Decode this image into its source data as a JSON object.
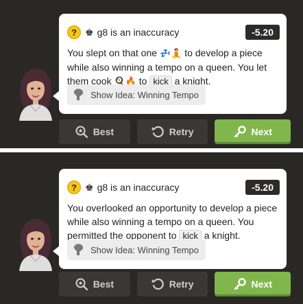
{
  "panels": [
    {
      "move": "g8",
      "verdict": "is an inaccuracy",
      "eval": "-5.20",
      "message": {
        "text1": "You slept on that one ",
        "emoji1": "💤🧘",
        "text2": " to develop a piece while also winning a tempo on a queen. You let them cook ",
        "emoji2": "🍳🔥",
        "text3": " to ",
        "tag": "kick",
        "text4": " a knight."
      },
      "idea": "Show Idea: Winning Tempo",
      "buttons": {
        "best": "Best",
        "retry": "Retry",
        "next": "Next"
      }
    },
    {
      "move": "g8",
      "verdict": "is an inaccuracy",
      "eval": "-5.20",
      "message": {
        "text1": "You overlooked an opportunity to develop a piece while also winning a tempo on a queen. You permitted the opponent to ",
        "tag": "kick",
        "text2": " a knight."
      },
      "idea": "Show Idea: Winning Tempo",
      "buttons": {
        "best": "Best",
        "retry": "Retry",
        "next": "Next"
      }
    }
  ],
  "colors": {
    "next": "#81b64c",
    "panel": "#2a2825",
    "badge": "#2d2b29",
    "inaccuracy": "#f5c518"
  },
  "icons": {
    "inaccuracy": "question-icon",
    "piece": "king-icon",
    "idea": "lightbulb-icon",
    "best": "magnifier-star-icon",
    "retry": "retry-icon",
    "next": "key-icon"
  }
}
